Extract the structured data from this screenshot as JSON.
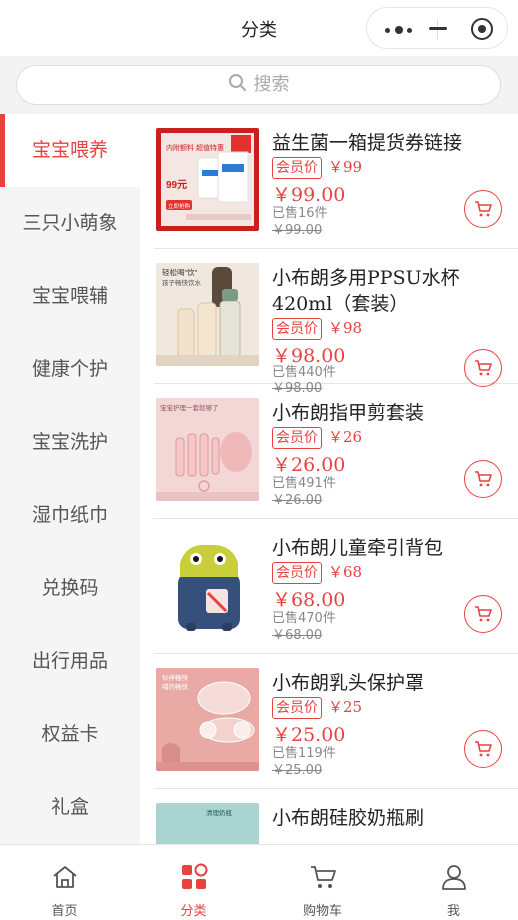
{
  "header": {
    "title": "分类"
  },
  "search": {
    "placeholder": "搜索"
  },
  "sidebar": {
    "categories": [
      "宝宝喂养",
      "三只小萌象",
      "宝宝喂辅",
      "健康个护",
      "宝宝洗护",
      "湿巾纸巾",
      "兑换码",
      "出行用品",
      "权益卡",
      "礼盒"
    ],
    "active_index": 0
  },
  "products": [
    {
      "name": "益生菌一箱提货券链接",
      "vip_label": "会员价",
      "vip_price": "￥99",
      "price": "￥99.00",
      "sold": "已售16件",
      "original": "￥99.00"
    },
    {
      "name": "小布朗多用PPSU水杯420ml（套装）",
      "vip_label": "会员价",
      "vip_price": "￥98",
      "price": "￥98.00",
      "sold": "已售440件",
      "original": "￥98.00"
    },
    {
      "name": "小布朗指甲剪套装",
      "vip_label": "会员价",
      "vip_price": "￥26",
      "price": "￥26.00",
      "sold": "已售491件",
      "original": "￥26.00"
    },
    {
      "name": "小布朗儿童牵引背包",
      "vip_label": "会员价",
      "vip_price": "￥68",
      "price": "￥68.00",
      "sold": "已售470件",
      "original": "￥68.00"
    },
    {
      "name": "小布朗乳头保护罩",
      "vip_label": "会员价",
      "vip_price": "￥25",
      "price": "￥25.00",
      "sold": "已售119件",
      "original": "￥25.00"
    },
    {
      "name": "小布朗硅胶奶瓶刷"
    }
  ],
  "thumb_text": {
    "p1_banner": "内附额料 超值特惠",
    "p1_price": "99元",
    "p1_tag": "立即抢购",
    "p2_line1": "轻松喝\"饮\"",
    "p2_line2": "孩子畅快饮水",
    "p3_line1": "宝宝护理一套就够了",
    "p5_line1": "伙伴畅快",
    "p5_line2": "哺的畅快",
    "p6_line1": "清理奶瓶"
  },
  "tabbar": {
    "tabs": [
      {
        "label": "首页",
        "icon": "home-icon"
      },
      {
        "label": "分类",
        "icon": "category-icon"
      },
      {
        "label": "购物车",
        "icon": "cart-icon"
      },
      {
        "label": "我",
        "icon": "user-icon"
      }
    ],
    "active_index": 1
  },
  "colors": {
    "accent": "#e64340",
    "sidebar_bg": "#f5f5f5",
    "text": "#333333"
  }
}
